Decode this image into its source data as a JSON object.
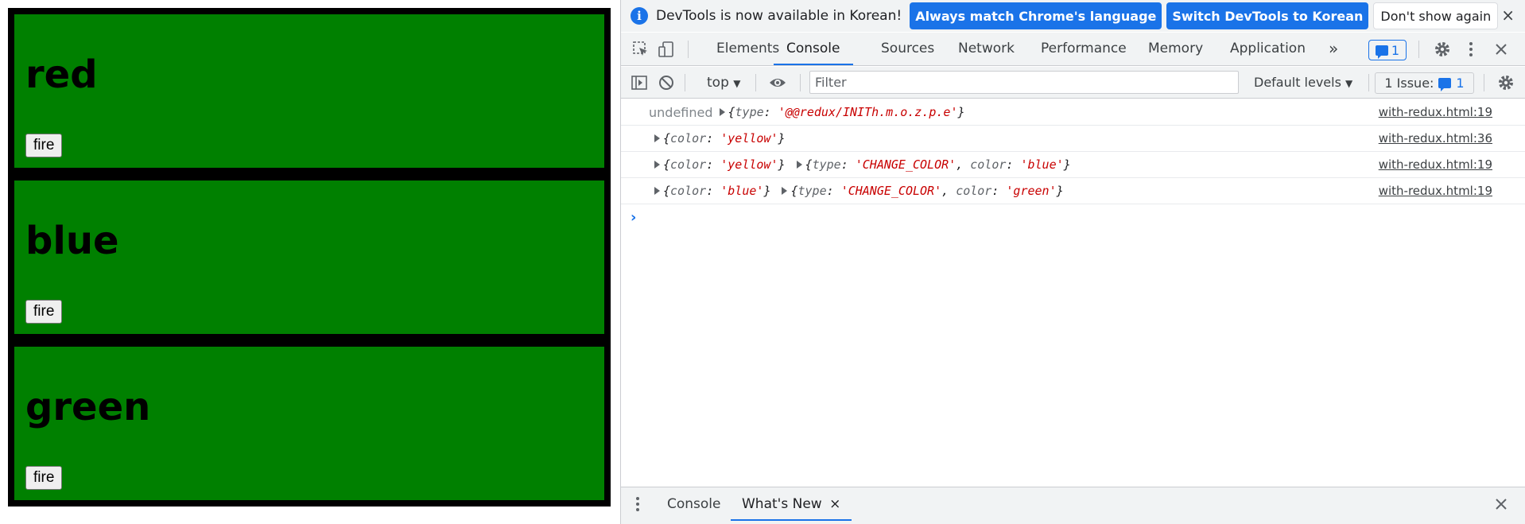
{
  "page": {
    "boxes": [
      {
        "title": "red",
        "button": "fire"
      },
      {
        "title": "blue",
        "button": "fire"
      },
      {
        "title": "green",
        "button": "fire"
      }
    ],
    "box_color": "#008000"
  },
  "devtools": {
    "infobar": {
      "message": "DevTools is now available in Korean!",
      "btn_match": "Always match Chrome's language",
      "btn_switch": "Switch DevTools to Korean",
      "btn_dismiss": "Don't show again",
      "close": "×"
    },
    "tabs": [
      "Elements",
      "Console",
      "Sources",
      "Network",
      "Performance",
      "Memory",
      "Application"
    ],
    "active_tab": "Console",
    "more_tabs": "»",
    "messages_count": "1",
    "toolbar": {
      "context": "top",
      "filter_placeholder": "Filter",
      "levels": "Default levels",
      "issues_label": "1 Issue:",
      "issues_count": "1"
    },
    "console": {
      "rows": [
        {
          "prefix": "undefined",
          "parts": [
            {
              "k": "type",
              "v": "'@@redux/INITh.m.o.z.p.e'"
            }
          ],
          "extra": null,
          "src": "with-redux.html:19"
        },
        {
          "prefix": "",
          "parts": [
            {
              "k": "color",
              "v": "'yellow'"
            }
          ],
          "extra": null,
          "src": "with-redux.html:36"
        },
        {
          "prefix": "",
          "parts": [
            {
              "k": "color",
              "v": "'yellow'"
            }
          ],
          "extra": [
            {
              "k": "type",
              "v": "'CHANGE_COLOR'"
            },
            {
              "k": "color",
              "v": "'blue'"
            }
          ],
          "src": "with-redux.html:19"
        },
        {
          "prefix": "",
          "parts": [
            {
              "k": "color",
              "v": "'blue'"
            }
          ],
          "extra": [
            {
              "k": "type",
              "v": "'CHANGE_COLOR'"
            },
            {
              "k": "color",
              "v": "'green'"
            }
          ],
          "src": "with-redux.html:19"
        }
      ],
      "prompt": "›"
    },
    "drawer": {
      "tabs": [
        "Console",
        "What's New"
      ],
      "active": "What's New",
      "tab_close": "×",
      "close": "×"
    },
    "accent": "#1a73e8"
  }
}
